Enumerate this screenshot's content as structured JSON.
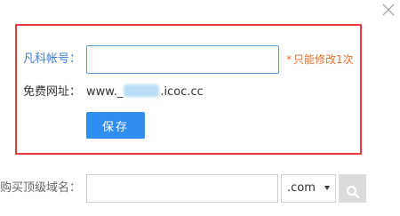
{
  "dialog": {
    "close_icon": "close-icon"
  },
  "account": {
    "label": "凡科帐号：",
    "value": "",
    "placeholder": "",
    "hint_star": "*",
    "hint": "只能修改1次"
  },
  "url": {
    "label": "免费网址：",
    "prefix": "www.",
    "masked_part": "_",
    "suffix": ".icoc.cc"
  },
  "save_label": "保存",
  "domain_purchase": {
    "label": "购买顶级域名：",
    "value": "",
    "tld": ".com",
    "search_icon": "search-icon"
  },
  "colors": {
    "highlight_border": "#e83a3a",
    "accent_blue": "#2f8ef0",
    "label_blue": "#3d7ed4",
    "hint_orange": "#e8702a"
  }
}
